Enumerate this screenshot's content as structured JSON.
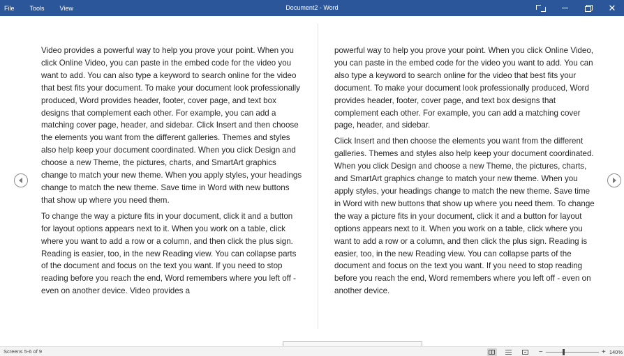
{
  "titlebar": {
    "menu": [
      "File",
      "Tools",
      "View"
    ],
    "title": "Document2 - Word",
    "bg_color": "#2b579a",
    "controls": {
      "focus_icon": "restore-focus-icon",
      "minimize_icon": "minimize-icon",
      "restore_icon": "restore-icon",
      "close_icon": "close-icon",
      "close_glyph": "✕"
    }
  },
  "reading": {
    "left_column": [
      "Video provides a powerful way to help you prove your point. When you click Online Video, you can paste in the embed code for the video you want to add. You can also type a keyword to search online for the video that best fits your document. To make your document look professionally produced, Word provides header, footer, cover page, and text box designs that complement each other. For example, you can add a matching cover page, header, and sidebar. Click Insert and then choose the elements you want from the different galleries. Themes and styles also help keep your document coordinated. When you click Design and choose a new Theme, the pictures, charts, and SmartArt graphics change to match your new theme. When you apply styles, your headings change to match the new theme. Save time in Word with new buttons that show up where you need them.",
      "To change the way a picture fits in your document, click it and a button for layout options appears next to it. When you work on a table, click where you want to add a row or a column, and then click the plus sign. Reading is easier, too, in the new Reading view. You can collapse parts of the document and focus on the text you want. If you need to stop reading before you reach the end, Word remem­bers where you left off - even on another device. Video provides a"
    ],
    "right_column": [
      "powerful way to help you prove your point. When you click Online Video, you can paste in the embed code for the video you want to add. You can also type a keyword to search online for the video that best fits your document. To make your document look profession­ally produced, Word provides header, footer, cover page, and text box designs that complement each other. For example, you can add a matching cover page, header, and sidebar.",
      "Click Insert and then choose the elements you want from the differ­ent galleries. Themes and styles also help keep your document co­ordinated. When you click Design and choose a new Theme, the pic­tures, charts, and SmartArt graphics change to match your new theme. When you apply styles, your headings change to match the new theme. Save time in Word with new buttons that show up where you need them. To change the way a picture fits in your doc­ument, click it and a button for layout options appears next to it. When you work on a table, click where you want to add a row or a column, and then click the plus sign. Reading is easier, too, in the new Reading view. You can collapse parts of the document and fo­cus on the text you want. If you need to stop reading before you reach the end, Word remembers where you left off - even on an­other device."
    ],
    "prev_icon": "chevron-left-icon",
    "next_icon": "chevron-right-icon"
  },
  "statusbar": {
    "screens": "Screens 5-6 of 9",
    "views": [
      "read-mode-icon",
      "print-layout-icon",
      "web-layout-icon"
    ],
    "active_view": "read-mode-icon",
    "zoom_minus": "−",
    "zoom_plus": "+",
    "zoom_level": "140%",
    "zoom_position": 0.32
  }
}
